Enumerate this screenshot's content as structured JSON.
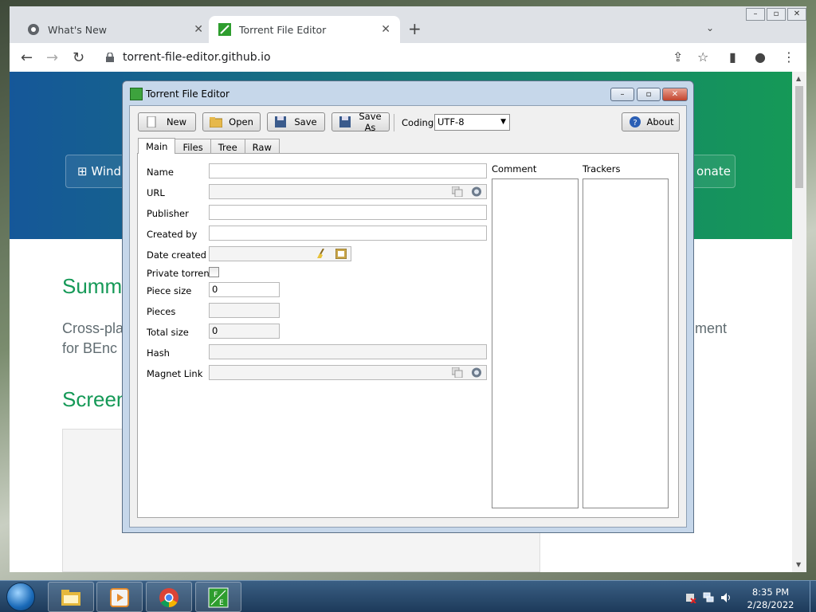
{
  "browser": {
    "tabs": [
      {
        "title": "What's New",
        "active": false,
        "icon": "chrome-icon"
      },
      {
        "title": "Torrent File Editor",
        "active": true,
        "icon": "tfe-icon"
      }
    ],
    "url": "torrent-file-editor.github.io"
  },
  "website": {
    "download_buttons": [
      "Wind",
      "onate"
    ],
    "summary_heading": "Summ",
    "summary_text_line1": "Cross-pla",
    "summary_text_line1_end": "ment",
    "summary_text_line2": "for BEnc",
    "screenshots_heading": "Screen"
  },
  "editor": {
    "title": "Torrent File Editor",
    "toolbar": {
      "new": "New",
      "open": "Open",
      "save": "Save",
      "save_as": "Save As",
      "coding_label": "Coding",
      "coding_value": "UTF-8",
      "about": "About"
    },
    "tabs": [
      "Main",
      "Files",
      "Tree",
      "Raw"
    ],
    "selected_tab": "Main",
    "fields": {
      "name": {
        "label": "Name",
        "value": ""
      },
      "url": {
        "label": "URL",
        "value": ""
      },
      "publisher": {
        "label": "Publisher",
        "value": ""
      },
      "created_by": {
        "label": "Created by",
        "value": ""
      },
      "date_created": {
        "label": "Date created",
        "value": ""
      },
      "private_torrent": {
        "label": "Private torrent",
        "checked": false
      },
      "piece_size": {
        "label": "Piece size",
        "value": "0"
      },
      "pieces": {
        "label": "Pieces",
        "value": ""
      },
      "total_size": {
        "label": "Total size",
        "value": "0"
      },
      "hash": {
        "label": "Hash",
        "value": ""
      },
      "magnet_link": {
        "label": "Magnet Link",
        "value": ""
      }
    },
    "comment_label": "Comment",
    "trackers_label": "Trackers"
  },
  "taskbar": {
    "time": "8:35 PM",
    "date": "2/28/2022",
    "pinned": [
      "explorer-icon",
      "media-player-icon",
      "chrome-icon",
      "torrent-file-editor-icon"
    ]
  },
  "colors": {
    "site_green": "#159957",
    "site_blue": "#155799",
    "editor_frame": "#c6d7ea"
  }
}
